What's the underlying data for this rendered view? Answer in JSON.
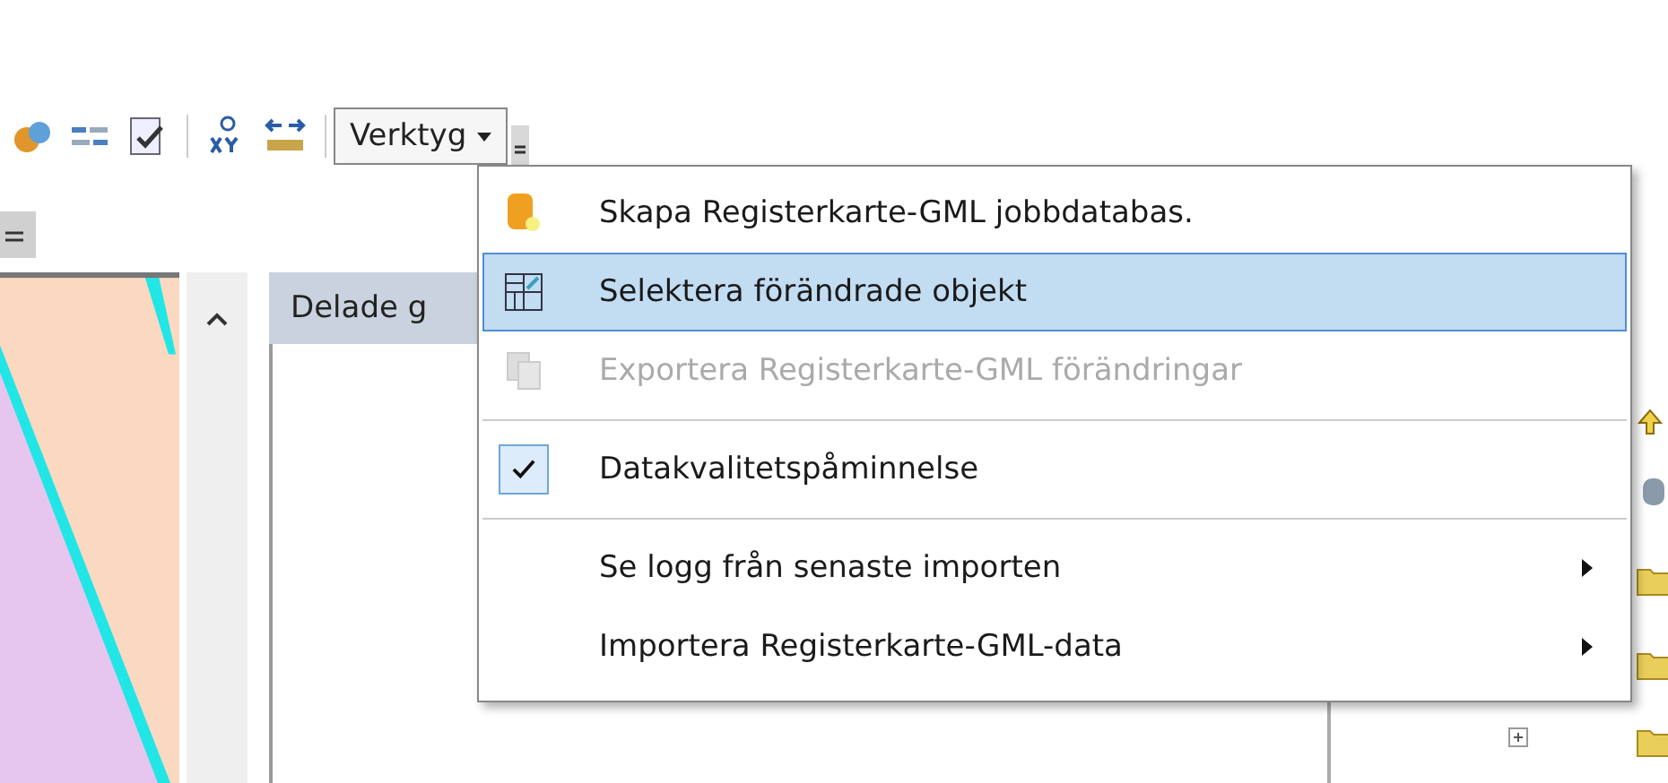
{
  "toolbar": {
    "menu_button": {
      "label": "Verktyg",
      "expanded": true
    }
  },
  "panel_tab": {
    "label": "Delade g"
  },
  "menu": {
    "items": [
      {
        "label": "Skapa Registerkarte-GML jobbdatabas.",
        "kind": "command",
        "selected": false,
        "disabled": false
      },
      {
        "label": "Selektera förändrade objekt",
        "kind": "command",
        "selected": true,
        "disabled": false
      },
      {
        "label": "Exportera Registerkarte-GML förändringar",
        "kind": "command",
        "selected": false,
        "disabled": true
      },
      {
        "kind": "separator"
      },
      {
        "label": "Datakvalitetspåminnelse",
        "kind": "toggle",
        "selected": false,
        "disabled": false,
        "checked": true
      },
      {
        "kind": "separator"
      },
      {
        "label": "Se logg från senaste importen",
        "kind": "submenu",
        "selected": false,
        "disabled": false
      },
      {
        "label": "Importera Registerkarte-GML-data",
        "kind": "submenu",
        "selected": false,
        "disabled": false
      }
    ]
  }
}
